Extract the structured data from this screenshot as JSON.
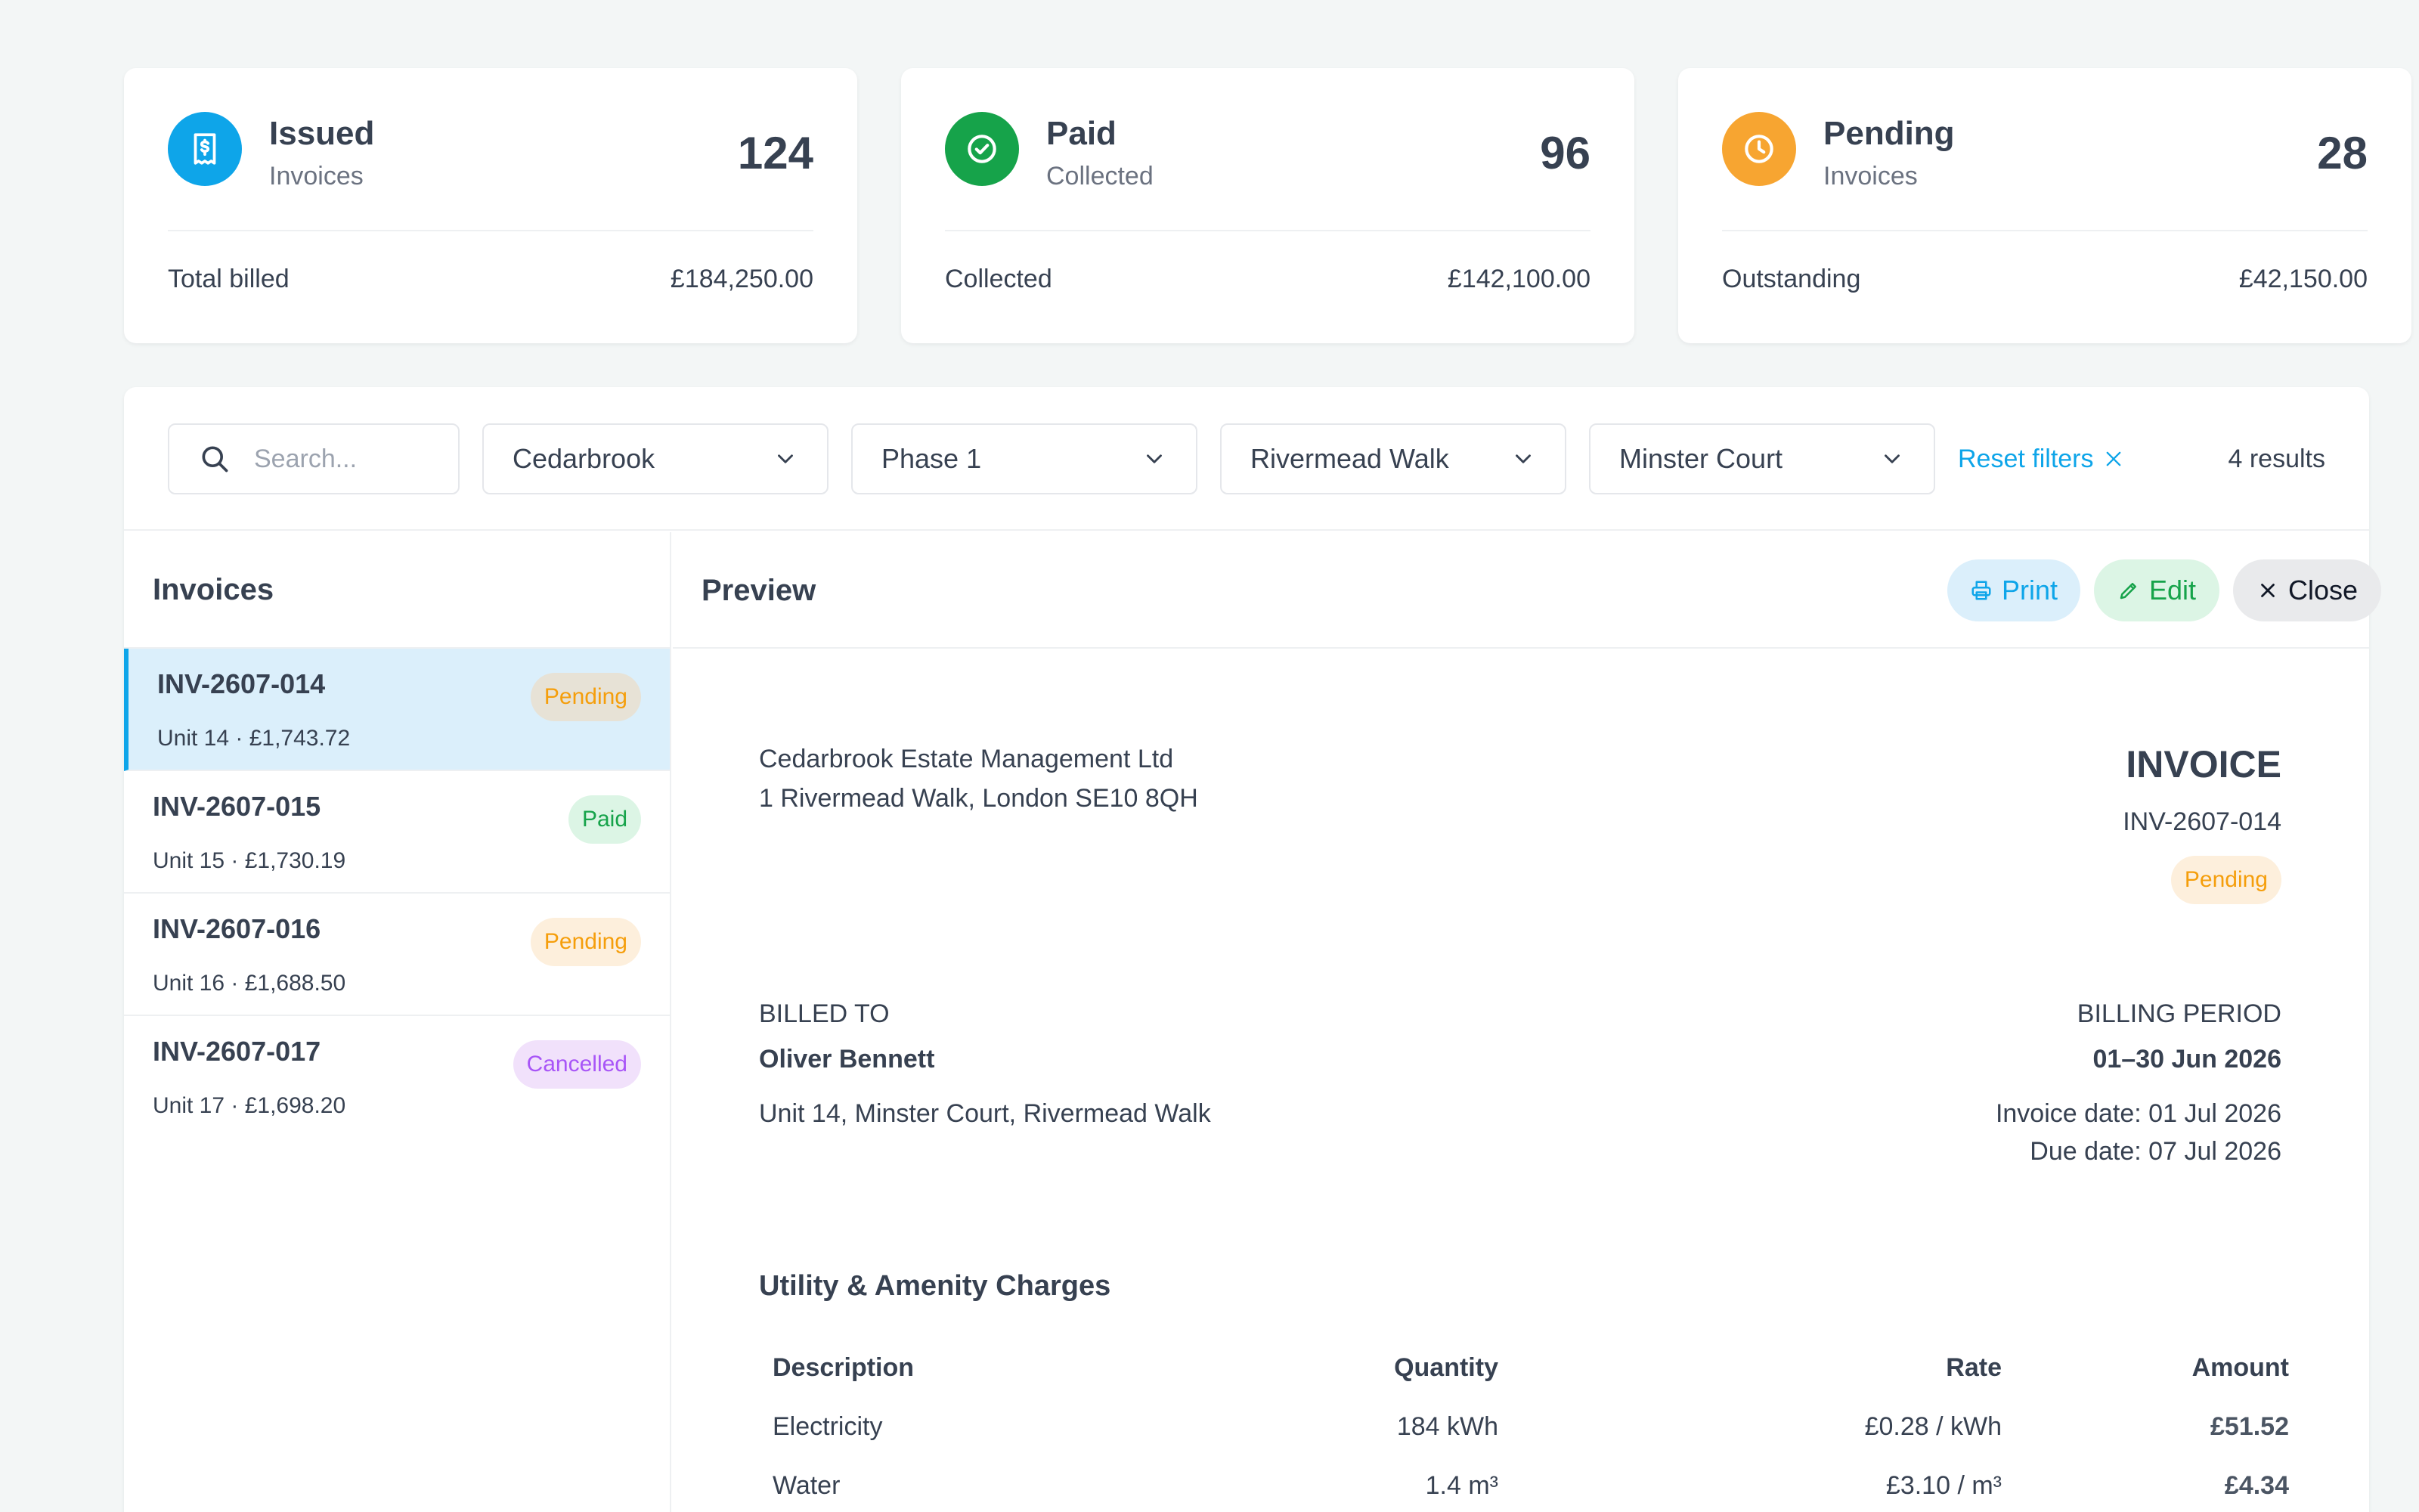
{
  "stats": [
    {
      "title": "Issued",
      "subtitle": "Invoices",
      "count": "124",
      "foot_label": "Total billed",
      "foot_value": "£184,250.00",
      "icon": "receipt-icon",
      "color": "#0ea5e9"
    },
    {
      "title": "Paid",
      "subtitle": "Collected",
      "count": "96",
      "foot_label": "Collected",
      "foot_value": "£142,100.00",
      "icon": "check-circle-icon",
      "color": "#16a34a"
    },
    {
      "title": "Pending",
      "subtitle": "Invoices",
      "count": "28",
      "foot_label": "Outstanding",
      "foot_value": "£42,150.00",
      "icon": "clock-icon",
      "color": "#f7a531"
    }
  ],
  "filters": {
    "search_placeholder": "Search...",
    "estate": "Cedarbrook",
    "phase": "Phase 1",
    "street": "Rivermead Walk",
    "building": "Minster Court",
    "reset_label": "Reset filters",
    "results": "4 results"
  },
  "list": {
    "title": "Invoices",
    "items": [
      {
        "number": "INV-2607-014",
        "meta": "Unit 14 · £1,743.72",
        "status": "Pending"
      },
      {
        "number": "INV-2607-015",
        "meta": "Unit 15 · £1,730.19",
        "status": "Paid"
      },
      {
        "number": "INV-2607-016",
        "meta": "Unit 16 · £1,688.50",
        "status": "Pending"
      },
      {
        "number": "INV-2607-017",
        "meta": "Unit 17 · £1,698.20",
        "status": "Cancelled"
      }
    ]
  },
  "preview": {
    "title": "Preview",
    "print_label": "Print",
    "edit_label": "Edit",
    "close_label": "Close"
  },
  "invoice": {
    "company_name": "Cedarbrook Estate Management Ltd",
    "company_address": "1 Rivermead Walk, London SE10 8QH",
    "heading": "INVOICE",
    "number": "INV-2607-014",
    "status": "Pending",
    "billed_to_label": "BILLED TO",
    "billed_to_name": "Oliver Bennett",
    "billed_to_address": "Unit 14, Minster Court, Rivermead Walk",
    "period_label": "BILLING PERIOD",
    "period_value": "01–30 Jun 2026",
    "invoice_date": "Invoice date: 01 Jul 2026",
    "due_date": "Due date: 07 Jul 2026",
    "charges_title": "Utility & Amenity Charges",
    "columns": {
      "description": "Description",
      "quantity": "Quantity",
      "rate": "Rate",
      "amount": "Amount"
    },
    "charges": [
      {
        "description": "Electricity",
        "quantity": "184 kWh",
        "rate": "£0.28 / kWh",
        "amount": "£51.52"
      },
      {
        "description": "Water",
        "quantity": "1.4 m³",
        "rate": "£3.10 / m³",
        "amount": "£4.34"
      }
    ]
  },
  "colors": {
    "accent": "#0ea5e9",
    "paid": "#16a34a",
    "pending": "#f59e0b",
    "cancelled": "#a855f7"
  }
}
